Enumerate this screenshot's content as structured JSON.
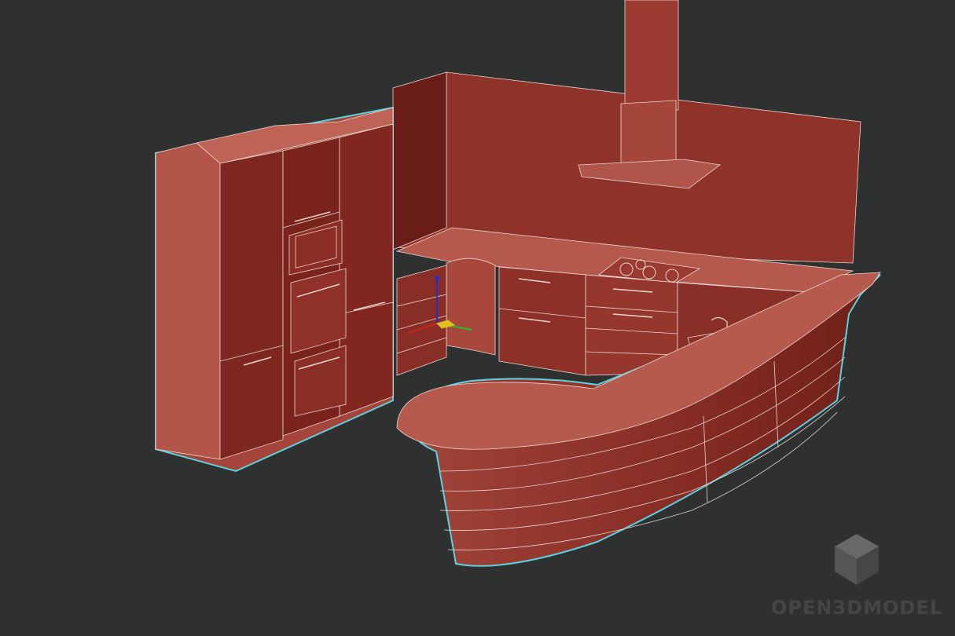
{
  "viewport": {
    "background_color": "#2f3030",
    "object_color": "#9a3a30",
    "selection_outline_color": "#5fd0e0"
  },
  "objects": {
    "tall_cabinets": "tall-cabinet-column",
    "back_wall": "back-wall-panel",
    "range_hood": "range-hood",
    "cooktop": "gas-cooktop",
    "sink": "sink",
    "curved_island": "curved-bar-counter",
    "transform_gizmo": "xyz-axis-gizmo"
  },
  "watermark": {
    "text": "OPEN3DMODEL",
    "icon": "cube-logo-icon"
  }
}
